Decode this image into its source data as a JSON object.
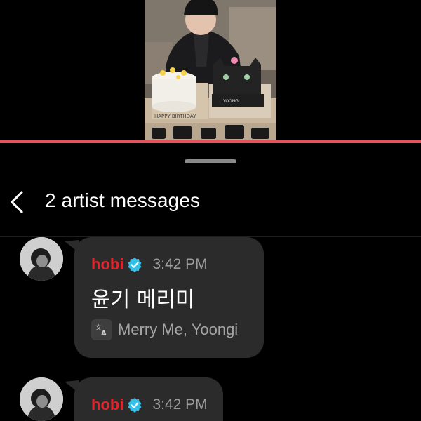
{
  "video": {
    "progress_percent": 100,
    "progress_color": "#e8505b",
    "cake_left_text": "HAPPY BIRTHDAY",
    "cake_right_text": "YOONGI"
  },
  "header": {
    "back_icon": "chevron-left-icon",
    "title": "2 artist messages"
  },
  "messages": [
    {
      "sender": "hobi",
      "verified_icon": "verified-check-icon",
      "time": "3:42 PM",
      "text": "윤기 메리미",
      "translate_icon": "translate-icon",
      "translation": "Merry Me, Yoongi"
    },
    {
      "sender": "hobi",
      "verified_icon": "verified-check-icon",
      "time": "3:42 PM"
    }
  ],
  "colors": {
    "background": "#000000",
    "bubble": "#2b2b2b",
    "sender": "#e0262d",
    "verified": "#34c0e8",
    "muted_text": "#9c9c9c"
  }
}
